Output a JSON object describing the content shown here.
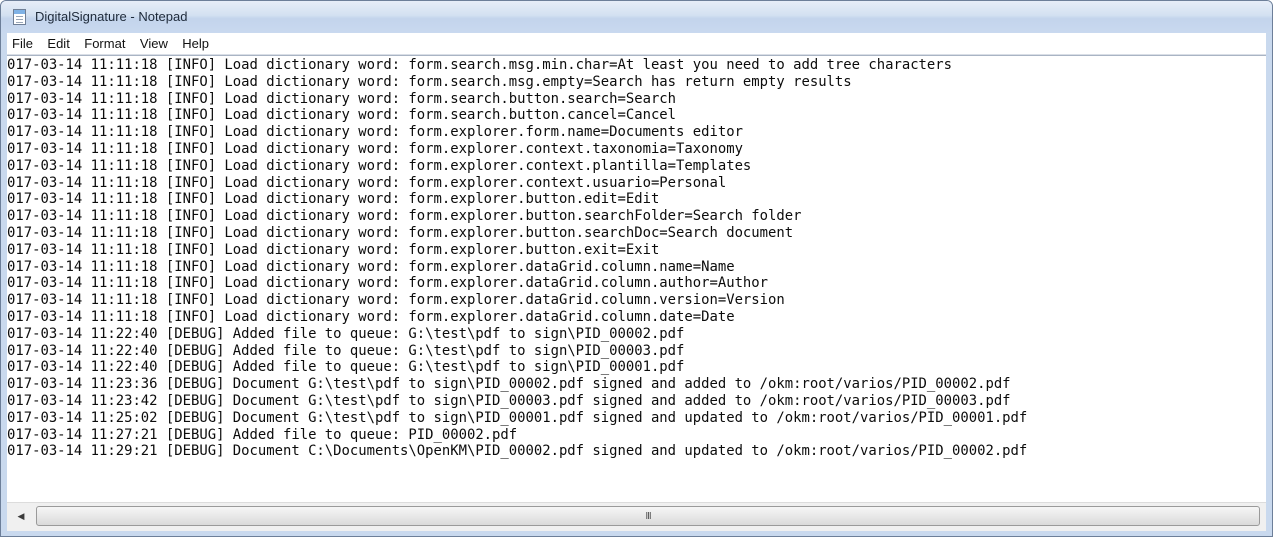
{
  "window": {
    "title": "DigitalSignature - Notepad"
  },
  "menu": [
    "File",
    "Edit",
    "Format",
    "View",
    "Help"
  ],
  "editor": {
    "lines": [
      "017-03-14 11:11:18 [INFO] Load dictionary word: form.search.msg.min.char=At least you need to add tree characters",
      "017-03-14 11:11:18 [INFO] Load dictionary word: form.search.msg.empty=Search has return empty results",
      "017-03-14 11:11:18 [INFO] Load dictionary word: form.search.button.search=Search",
      "017-03-14 11:11:18 [INFO] Load dictionary word: form.search.button.cancel=Cancel",
      "017-03-14 11:11:18 [INFO] Load dictionary word: form.explorer.form.name=Documents editor",
      "017-03-14 11:11:18 [INFO] Load dictionary word: form.explorer.context.taxonomia=Taxonomy",
      "017-03-14 11:11:18 [INFO] Load dictionary word: form.explorer.context.plantilla=Templates",
      "017-03-14 11:11:18 [INFO] Load dictionary word: form.explorer.context.usuario=Personal",
      "017-03-14 11:11:18 [INFO] Load dictionary word: form.explorer.button.edit=Edit",
      "017-03-14 11:11:18 [INFO] Load dictionary word: form.explorer.button.searchFolder=Search folder",
      "017-03-14 11:11:18 [INFO] Load dictionary word: form.explorer.button.searchDoc=Search document",
      "017-03-14 11:11:18 [INFO] Load dictionary word: form.explorer.button.exit=Exit",
      "017-03-14 11:11:18 [INFO] Load dictionary word: form.explorer.dataGrid.column.name=Name",
      "017-03-14 11:11:18 [INFO] Load dictionary word: form.explorer.dataGrid.column.author=Author",
      "017-03-14 11:11:18 [INFO] Load dictionary word: form.explorer.dataGrid.column.version=Version",
      "017-03-14 11:11:18 [INFO] Load dictionary word: form.explorer.dataGrid.column.date=Date",
      "017-03-14 11:22:40 [DEBUG] Added file to queue: G:\\test\\pdf to sign\\PID_00002.pdf",
      "017-03-14 11:22:40 [DEBUG] Added file to queue: G:\\test\\pdf to sign\\PID_00003.pdf",
      "017-03-14 11:22:40 [DEBUG] Added file to queue: G:\\test\\pdf to sign\\PID_00001.pdf",
      "017-03-14 11:23:36 [DEBUG] Document G:\\test\\pdf to sign\\PID_00002.pdf signed and added to /okm:root/varios/PID_00002.pdf",
      "017-03-14 11:23:42 [DEBUG] Document G:\\test\\pdf to sign\\PID_00003.pdf signed and added to /okm:root/varios/PID_00003.pdf",
      "017-03-14 11:25:02 [DEBUG] Document G:\\test\\pdf to sign\\PID_00001.pdf signed and updated to /okm:root/varios/PID_00001.pdf",
      "017-03-14 11:27:21 [DEBUG] Added file to queue: PID_00002.pdf",
      "017-03-14 11:29:21 [DEBUG] Document C:\\Documents\\OpenKM\\PID_00002.pdf signed and updated to /okm:root/varios/PID_00002.pdf"
    ]
  },
  "scrollbar": {
    "grip": "III",
    "left_arrow": "◀"
  },
  "icons": {
    "app": "notepad-icon"
  },
  "colors": {
    "frame": "#c9d9ee",
    "text": "#0c0c0c",
    "background": "#ffffff"
  }
}
